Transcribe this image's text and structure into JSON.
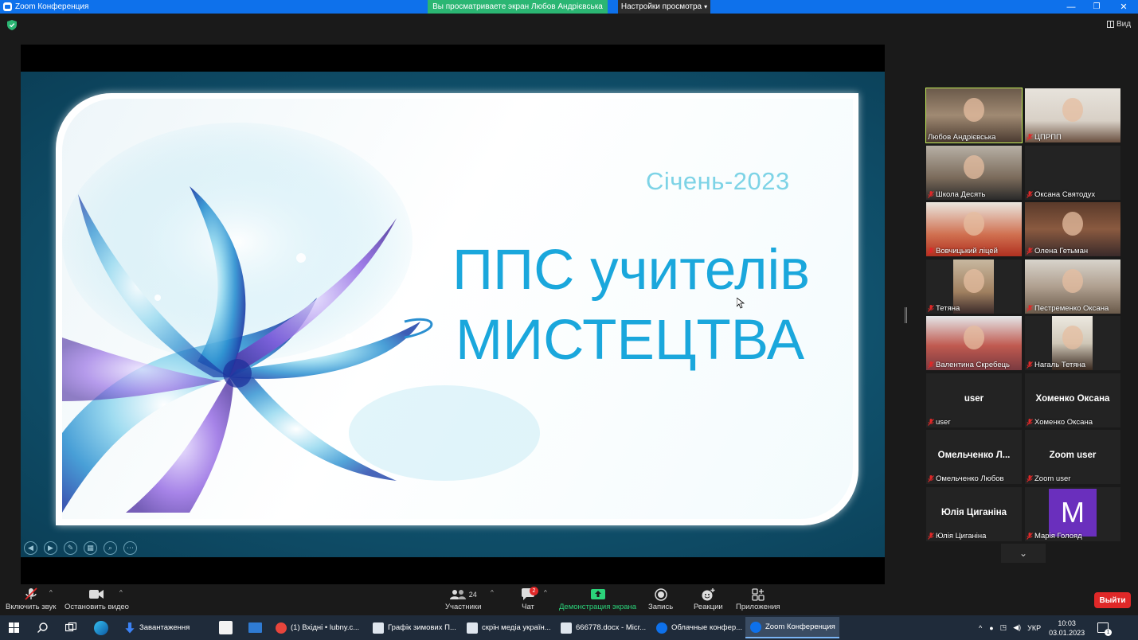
{
  "window": {
    "title": "Zoom Конференция",
    "share_banner": "Вы просматриваете экран Любов Андрієвська",
    "view_settings": "Настройки просмотра",
    "view_button": "Вид"
  },
  "slide": {
    "date": "Січень-2023",
    "title_line1": "ППС учителів",
    "title_line2": "МИСТЕЦТВА"
  },
  "gallery": {
    "participants": [
      {
        "name": "Любов Андрієвська",
        "video": true,
        "active": true
      },
      {
        "name": "ЦПРПП",
        "video": true
      },
      {
        "name": "Школа Десять",
        "video": true
      },
      {
        "name": "Оксана Святодух",
        "video": false
      },
      {
        "name": "Вовчицький ліцей",
        "video": true
      },
      {
        "name": "Олена Гетьман",
        "video": true
      },
      {
        "name": "Тетяна",
        "video": true
      },
      {
        "name": "Пестременко Оксана",
        "video": true
      },
      {
        "name": "Валентина Скребець",
        "video": true
      },
      {
        "name": "Нагаль Тетяна",
        "video": true
      },
      {
        "name": "user",
        "big": "user"
      },
      {
        "name": "Хоменко Оксана",
        "big": "Хоменко Оксана"
      },
      {
        "name": "Омельченко Любов",
        "big": "Омельченко  Л..."
      },
      {
        "name": "Zoom user",
        "big": "Zoom user"
      },
      {
        "name": "Юлія Циганіна",
        "big": "Юлія Циганіна"
      },
      {
        "name": "Марія Голояд",
        "avatar": "M"
      }
    ]
  },
  "toolbar": {
    "unmute": "Включить звук",
    "stop_video": "Остановить видео",
    "participants": "Участники",
    "participants_count": "24",
    "chat": "Чат",
    "chat_badge": "2",
    "share": "Демонстрация экрана",
    "record": "Запись",
    "reactions": "Реакции",
    "apps": "Приложения",
    "leave": "Выйти"
  },
  "taskbar": {
    "items": [
      {
        "label": "Завантаження",
        "color": "#3b82f6"
      },
      {
        "label": "(1) Вхідні • lubny.c...",
        "color": "#e8453c"
      },
      {
        "label": "Графік зимових П...",
        "color": "#dfe6ee"
      },
      {
        "label": "скрін медіа україн...",
        "color": "#dfe6ee"
      },
      {
        "label": "666778.docx - Micr...",
        "color": "#dfe6ee"
      },
      {
        "label": "Облачные конфер...",
        "color": "#0e71eb"
      },
      {
        "label": "Zoom Конференция",
        "color": "#0e71eb"
      }
    ],
    "lang": "УКР",
    "time": "10:03",
    "date": "03.01.2023",
    "notifications": "1"
  }
}
